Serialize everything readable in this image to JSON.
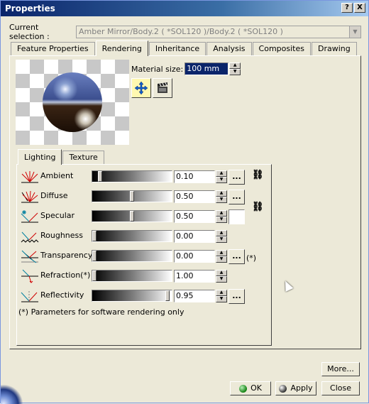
{
  "window": {
    "title": "Properties",
    "help_label": "?",
    "close_label": "X"
  },
  "selection": {
    "label": "Current selection :",
    "value": "Amber Mirror/Body.2 ( *SOL120 )/Body.2 ( *SOL120 )"
  },
  "tabs": [
    {
      "label": "Feature Properties"
    },
    {
      "label": "Rendering",
      "active": true
    },
    {
      "label": "Inheritance"
    },
    {
      "label": "Analysis"
    },
    {
      "label": "Composites"
    },
    {
      "label": "Drawing"
    }
  ],
  "material_size": {
    "label": "Material size:",
    "value": "100 mm"
  },
  "sub_tabs": [
    {
      "label": "Lighting",
      "active": true
    },
    {
      "label": "Texture"
    }
  ],
  "properties": [
    {
      "label": "Ambient",
      "value": "0.10",
      "level": 0.1,
      "icon": "ambient-icon",
      "has_color": true
    },
    {
      "label": "Diffuse",
      "value": "0.50",
      "level": 0.5,
      "icon": "diffuse-icon",
      "has_color": true
    },
    {
      "label": "Specular",
      "value": "0.50",
      "level": 0.5,
      "icon": "specular-icon",
      "has_color": true
    },
    {
      "label": "Roughness",
      "value": "0.00",
      "level": 0.0,
      "icon": "roughness-icon",
      "has_color": false
    },
    {
      "label": "Transparency",
      "value": "0.00",
      "level": 0.0,
      "icon": "transparency-icon",
      "has_color": true
    },
    {
      "label": "Refraction(*)",
      "value": "1.00",
      "level": 0.0,
      "icon": "refraction-icon",
      "has_color": false
    },
    {
      "label": "Reflectivity",
      "value": "0.95",
      "level": 0.95,
      "icon": "reflectivity-icon",
      "has_color": true
    }
  ],
  "ellipsis_label": "...",
  "transparency_note_marker": "(*)",
  "footnote": "(*) Parameters for software rendering only",
  "buttons": {
    "more": "More...",
    "ok": "OK",
    "apply": "Apply",
    "close": "Close"
  }
}
